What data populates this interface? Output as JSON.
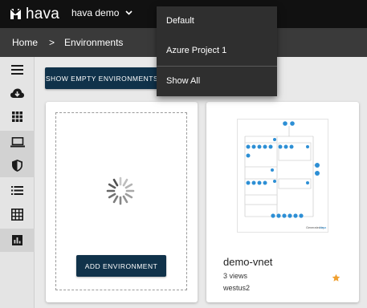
{
  "header": {
    "brand": "hava",
    "org_name": "hava demo"
  },
  "breadcrumb": {
    "home": "Home",
    "separator": ">",
    "current": "Environments"
  },
  "sidebar": {
    "items": [
      {
        "name": "menu",
        "icon": "hamburger-icon"
      },
      {
        "name": "import",
        "icon": "cloud-download-icon"
      },
      {
        "name": "dashboard",
        "icon": "grid-icon"
      },
      {
        "name": "environments",
        "icon": "laptop-icon",
        "active": true
      },
      {
        "name": "security",
        "icon": "shield-icon",
        "active": true
      },
      {
        "name": "list",
        "icon": "list-icon"
      },
      {
        "name": "table",
        "icon": "table-icon"
      },
      {
        "name": "reports",
        "icon": "bar-chart-icon",
        "active": true
      }
    ]
  },
  "main": {
    "show_empty_label": "SHOW EMPTY ENVIRONMENTS",
    "add_label": "ADD ENVIRONMENT",
    "environment": {
      "name": "demo-vnet",
      "views": "3 views",
      "region": "westus2",
      "generated_by": "Generated by"
    }
  },
  "dropdown": {
    "items": [
      "Default",
      "Azure Project 1",
      "Show All"
    ]
  },
  "colors": {
    "primary": "#10324a",
    "topbar": "#111111",
    "crumbbar": "#3a3a3a",
    "star": "#f0a030",
    "node": "#2d8fd5"
  }
}
